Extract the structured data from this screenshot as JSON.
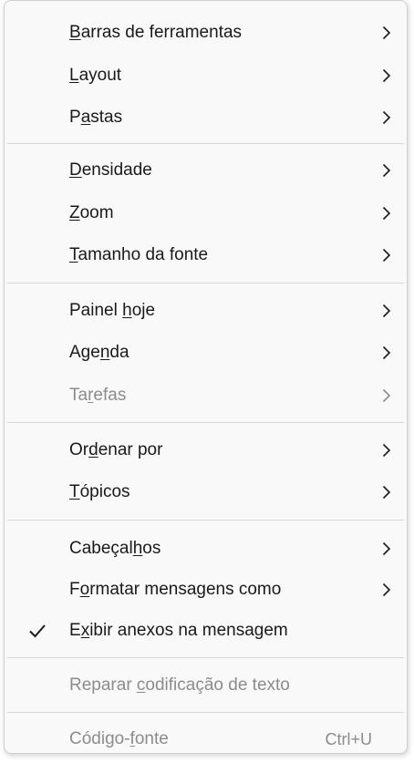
{
  "menu": {
    "items": [
      {
        "label": "Barras de ferramentas",
        "mnemonic_index": 0,
        "state": "enabled",
        "submenu": true
      },
      {
        "label": "Layout",
        "mnemonic_index": 0,
        "state": "enabled",
        "submenu": true
      },
      {
        "label": "Pastas",
        "mnemonic_index": 1,
        "state": "enabled",
        "submenu": true
      },
      {
        "label": "Densidade",
        "mnemonic_index": 0,
        "state": "enabled",
        "submenu": true
      },
      {
        "label": "Zoom",
        "mnemonic_index": 0,
        "state": "enabled",
        "submenu": true
      },
      {
        "label": "Tamanho da fonte",
        "mnemonic_index": 0,
        "state": "enabled",
        "submenu": true
      },
      {
        "label": "Painel hoje",
        "mnemonic_index": 7,
        "state": "enabled",
        "submenu": true
      },
      {
        "label": "Agenda",
        "mnemonic_index": 3,
        "state": "enabled",
        "submenu": true
      },
      {
        "label": "Tarefas",
        "mnemonic_index": 2,
        "state": "disabled",
        "submenu": true
      },
      {
        "label": "Ordenar por",
        "mnemonic_index": 2,
        "state": "enabled",
        "submenu": true
      },
      {
        "label": "Tópicos",
        "mnemonic_index": 0,
        "state": "enabled",
        "submenu": true
      },
      {
        "label": "Cabeçalhos",
        "mnemonic_index": 7,
        "state": "enabled",
        "submenu": true
      },
      {
        "label": "Formatar mensagens como",
        "mnemonic_index": 1,
        "state": "enabled",
        "submenu": true
      },
      {
        "label": "Exibir anexos na mensagem",
        "mnemonic_index": 1,
        "state": "enabled",
        "checked": true
      },
      {
        "label": "Reparar codificação de texto",
        "mnemonic_index": 8,
        "state": "disabled"
      },
      {
        "label": "Código-fonte",
        "mnemonic_index": 7,
        "state": "disabled",
        "shortcut": "Ctrl+U"
      }
    ]
  },
  "colors": {
    "background": "#f9f9f9",
    "text": "#1a1a1a",
    "disabled_text": "#8c8c8c",
    "separator": "#d7d7d7"
  }
}
